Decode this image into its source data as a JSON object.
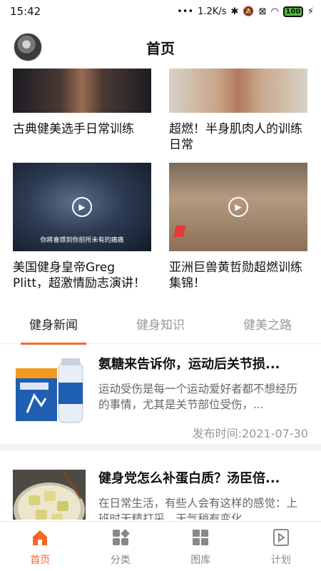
{
  "status": {
    "time": "15:42",
    "speed": "1.2K/s",
    "battery": "100"
  },
  "header": {
    "title": "首页"
  },
  "videos": [
    {
      "title": "古典健美选手日常训练"
    },
    {
      "title": "超燃！半身肌肉人的训练日常"
    },
    {
      "title": "美国健身皇帝Greg Plitt，超激情励志演讲！",
      "subtitle": "你將會感到你前所未有的痛痛"
    },
    {
      "title": "亚洲巨兽黄哲勋超燃训练集锦！"
    }
  ],
  "tabs": [
    {
      "label": "健身新闻",
      "active": true
    },
    {
      "label": "健身知识",
      "active": false
    },
    {
      "label": "健美之路",
      "active": false
    }
  ],
  "news": [
    {
      "title": "氨糖来告诉你，运动后关节损...",
      "desc": "运动受伤是每一个运动爱好者都不想经历的事情，尤其是关节部位受伤，...",
      "date": "发布时间:2021-07-30"
    },
    {
      "title": "健身党怎么补蛋白质？汤臣倍...",
      "desc": "在日常生活，有些人会有这样的感觉：上班时无精打采，天气稍有变化...",
      "date": ""
    }
  ],
  "nav": [
    {
      "label": "首页",
      "icon": "home-icon",
      "active": true
    },
    {
      "label": "分类",
      "icon": "category-icon",
      "active": false
    },
    {
      "label": "图库",
      "icon": "gallery-icon",
      "active": false
    },
    {
      "label": "计划",
      "icon": "plan-icon",
      "active": false
    }
  ],
  "colors": {
    "accent": "#f26a24"
  }
}
